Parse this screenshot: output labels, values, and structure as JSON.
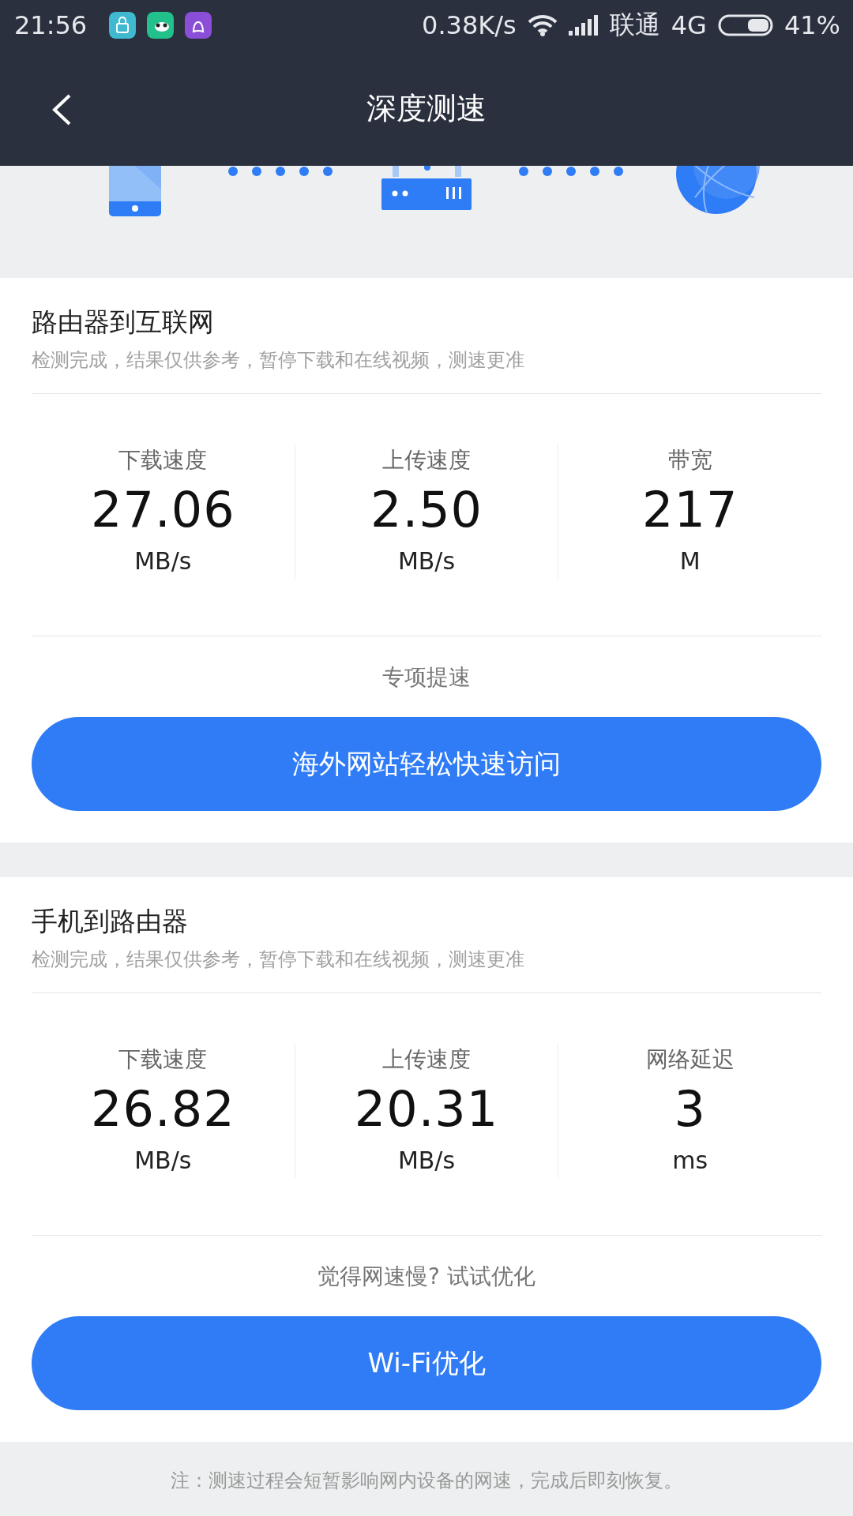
{
  "status_bar": {
    "time": "21:56",
    "net_speed": "0.38K/s",
    "carrier": "联通",
    "network": "4G",
    "battery": "41%"
  },
  "header": {
    "title": "深度测速"
  },
  "sections": [
    {
      "title": "路由器到互联网",
      "note": "检测完成，结果仅供参考，暂停下载和在线视频，测速更准",
      "metrics": [
        {
          "label": "下载速度",
          "value": "27.06",
          "unit": "MB/s"
        },
        {
          "label": "上传速度",
          "value": "2.50",
          "unit": "MB/s"
        },
        {
          "label": "带宽",
          "value": "217",
          "unit": "M"
        }
      ],
      "prompt": "专项提速",
      "button": "海外网站轻松快速访问"
    },
    {
      "title": "手机到路由器",
      "note": "检测完成，结果仅供参考，暂停下载和在线视频，测速更准",
      "metrics": [
        {
          "label": "下载速度",
          "value": "26.82",
          "unit": "MB/s"
        },
        {
          "label": "上传速度",
          "value": "20.31",
          "unit": "MB/s"
        },
        {
          "label": "网络延迟",
          "value": "3",
          "unit": "ms"
        }
      ],
      "prompt": "觉得网速慢? 试试优化",
      "button": "Wi-Fi优化"
    }
  ],
  "footer": "注：测速过程会短暂影响网内设备的网速，完成后即刻恢复。"
}
